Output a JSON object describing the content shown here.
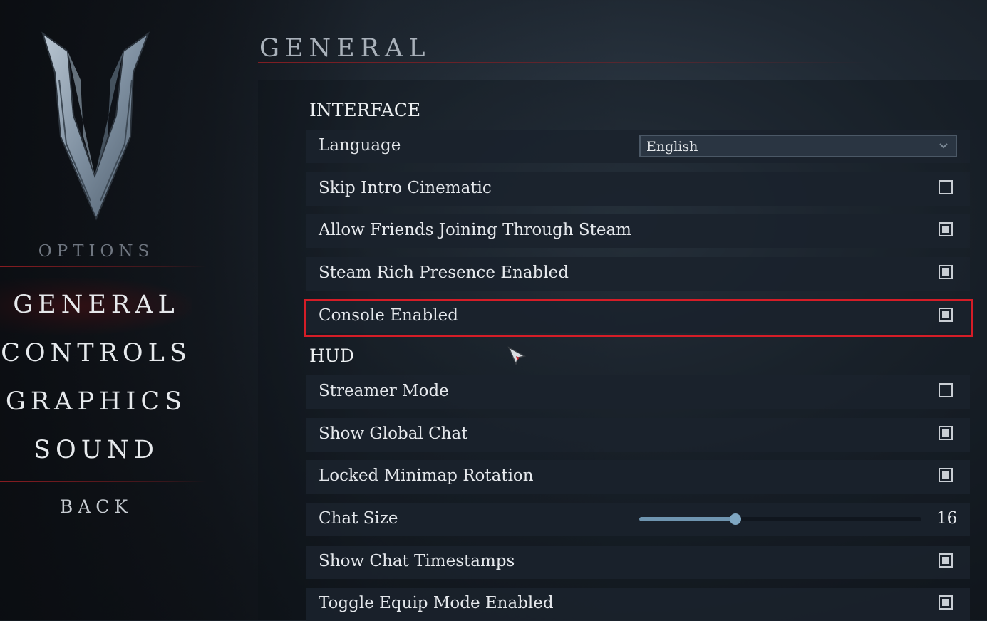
{
  "sidebar": {
    "options_title": "OPTIONS",
    "nav": [
      {
        "label": "GENERAL",
        "active": true
      },
      {
        "label": "CONTROLS",
        "active": false
      },
      {
        "label": "GRAPHICS",
        "active": false
      },
      {
        "label": "SOUND",
        "active": false
      }
    ],
    "back_label": "BACK"
  },
  "header": {
    "title": "GENERAL"
  },
  "sections": {
    "interface": {
      "title": "INTERFACE",
      "language": {
        "label": "Language",
        "value": "English"
      },
      "skip_intro": {
        "label": "Skip Intro Cinematic",
        "checked": false
      },
      "allow_friends": {
        "label": "Allow Friends Joining Through Steam",
        "checked": true
      },
      "steam_rich_presence": {
        "label": "Steam Rich Presence Enabled",
        "checked": true
      },
      "console_enabled": {
        "label": "Console Enabled",
        "checked": true,
        "highlighted": true
      }
    },
    "hud": {
      "title": "HUD",
      "streamer_mode": {
        "label": "Streamer Mode",
        "checked": false
      },
      "show_global_chat": {
        "label": "Show Global Chat",
        "checked": true
      },
      "locked_minimap": {
        "label": "Locked Minimap Rotation",
        "checked": true
      },
      "chat_size": {
        "label": "Chat Size",
        "value": "16",
        "fraction": 0.34
      },
      "show_chat_timestamps": {
        "label": "Show Chat Timestamps",
        "checked": true
      },
      "toggle_equip_mode": {
        "label": "Toggle Equip Mode Enabled",
        "checked": true
      }
    }
  },
  "colors": {
    "accent_red": "#d51d27",
    "slider_blue": "#7fa7c3"
  }
}
